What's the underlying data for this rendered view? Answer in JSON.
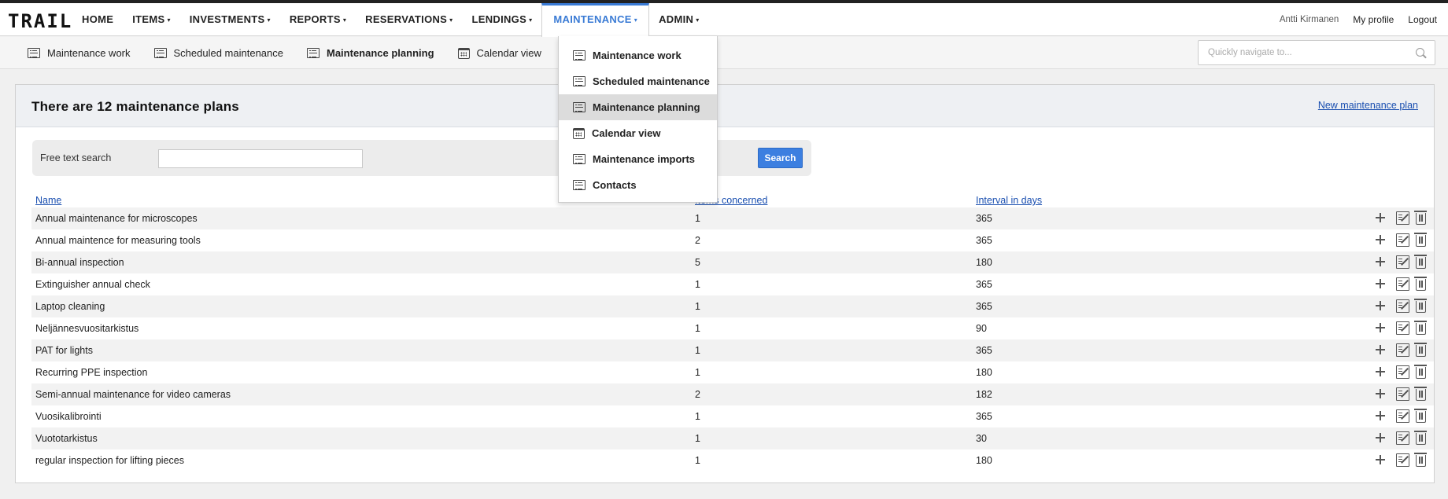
{
  "app": {
    "logo_text": "TRAIL"
  },
  "main_nav": [
    {
      "label": "HOME",
      "caret": false
    },
    {
      "label": "ITEMS",
      "caret": true
    },
    {
      "label": "INVESTMENTS",
      "caret": true
    },
    {
      "label": "REPORTS",
      "caret": true
    },
    {
      "label": "RESERVATIONS",
      "caret": true
    },
    {
      "label": "LENDINGS",
      "caret": true
    },
    {
      "label": "MAINTENANCE",
      "caret": true,
      "active": true
    },
    {
      "label": "ADMIN",
      "caret": true
    }
  ],
  "user": {
    "name": "Antti Kirmanen",
    "profile_label": "My profile",
    "logout_label": "Logout"
  },
  "sub_nav": [
    {
      "label": "Maintenance work",
      "icon": "list-icon"
    },
    {
      "label": "Scheduled maintenance",
      "icon": "list-icon"
    },
    {
      "label": "Maintenance planning",
      "icon": "list-icon",
      "current": true
    },
    {
      "label": "Calendar view",
      "icon": "calendar-icon"
    },
    {
      "label": "Contacts",
      "icon": "list-icon"
    }
  ],
  "quick_nav": {
    "placeholder": "Quickly navigate to..."
  },
  "dropdown": [
    {
      "label": "Maintenance work",
      "icon": "list-icon"
    },
    {
      "label": "Scheduled maintenance",
      "icon": "list-icon"
    },
    {
      "label": "Maintenance planning",
      "icon": "list-icon",
      "highlighted": true
    },
    {
      "label": "Calendar view",
      "icon": "calendar-icon"
    },
    {
      "label": "Maintenance imports",
      "icon": "list-icon"
    },
    {
      "label": "Contacts",
      "icon": "list-icon"
    }
  ],
  "panel": {
    "title": "There are 12 maintenance plans",
    "new_link": "New maintenance plan"
  },
  "search": {
    "label": "Free text search",
    "value": "",
    "button_label": "Search"
  },
  "table": {
    "headers": {
      "name": "Name",
      "concerned": "Items concerned",
      "interval": "Interval in days"
    },
    "rows": [
      {
        "name": "Annual maintenance for microscopes",
        "concerned": "1",
        "interval": "365"
      },
      {
        "name": "Annual maintence for measuring tools",
        "concerned": "2",
        "interval": "365"
      },
      {
        "name": "Bi-annual inspection",
        "concerned": "5",
        "interval": "180"
      },
      {
        "name": "Extinguisher annual check",
        "concerned": "1",
        "interval": "365"
      },
      {
        "name": "Laptop cleaning",
        "concerned": "1",
        "interval": "365"
      },
      {
        "name": "Neljännesvuositarkistus",
        "concerned": "1",
        "interval": "90"
      },
      {
        "name": "PAT for lights",
        "concerned": "1",
        "interval": "365"
      },
      {
        "name": "Recurring PPE inspection",
        "concerned": "1",
        "interval": "180"
      },
      {
        "name": "Semi-annual maintenance for video cameras",
        "concerned": "2",
        "interval": "182"
      },
      {
        "name": "Vuosikalibrointi",
        "concerned": "1",
        "interval": "365"
      },
      {
        "name": "Vuototarkistus",
        "concerned": "1",
        "interval": "30"
      },
      {
        "name": "regular inspection for lifting pieces",
        "concerned": "1",
        "interval": "180"
      }
    ]
  },
  "colors": {
    "accent": "#3a7bd5",
    "link": "#1a4fb0",
    "search_button": "#3c7fe0"
  }
}
